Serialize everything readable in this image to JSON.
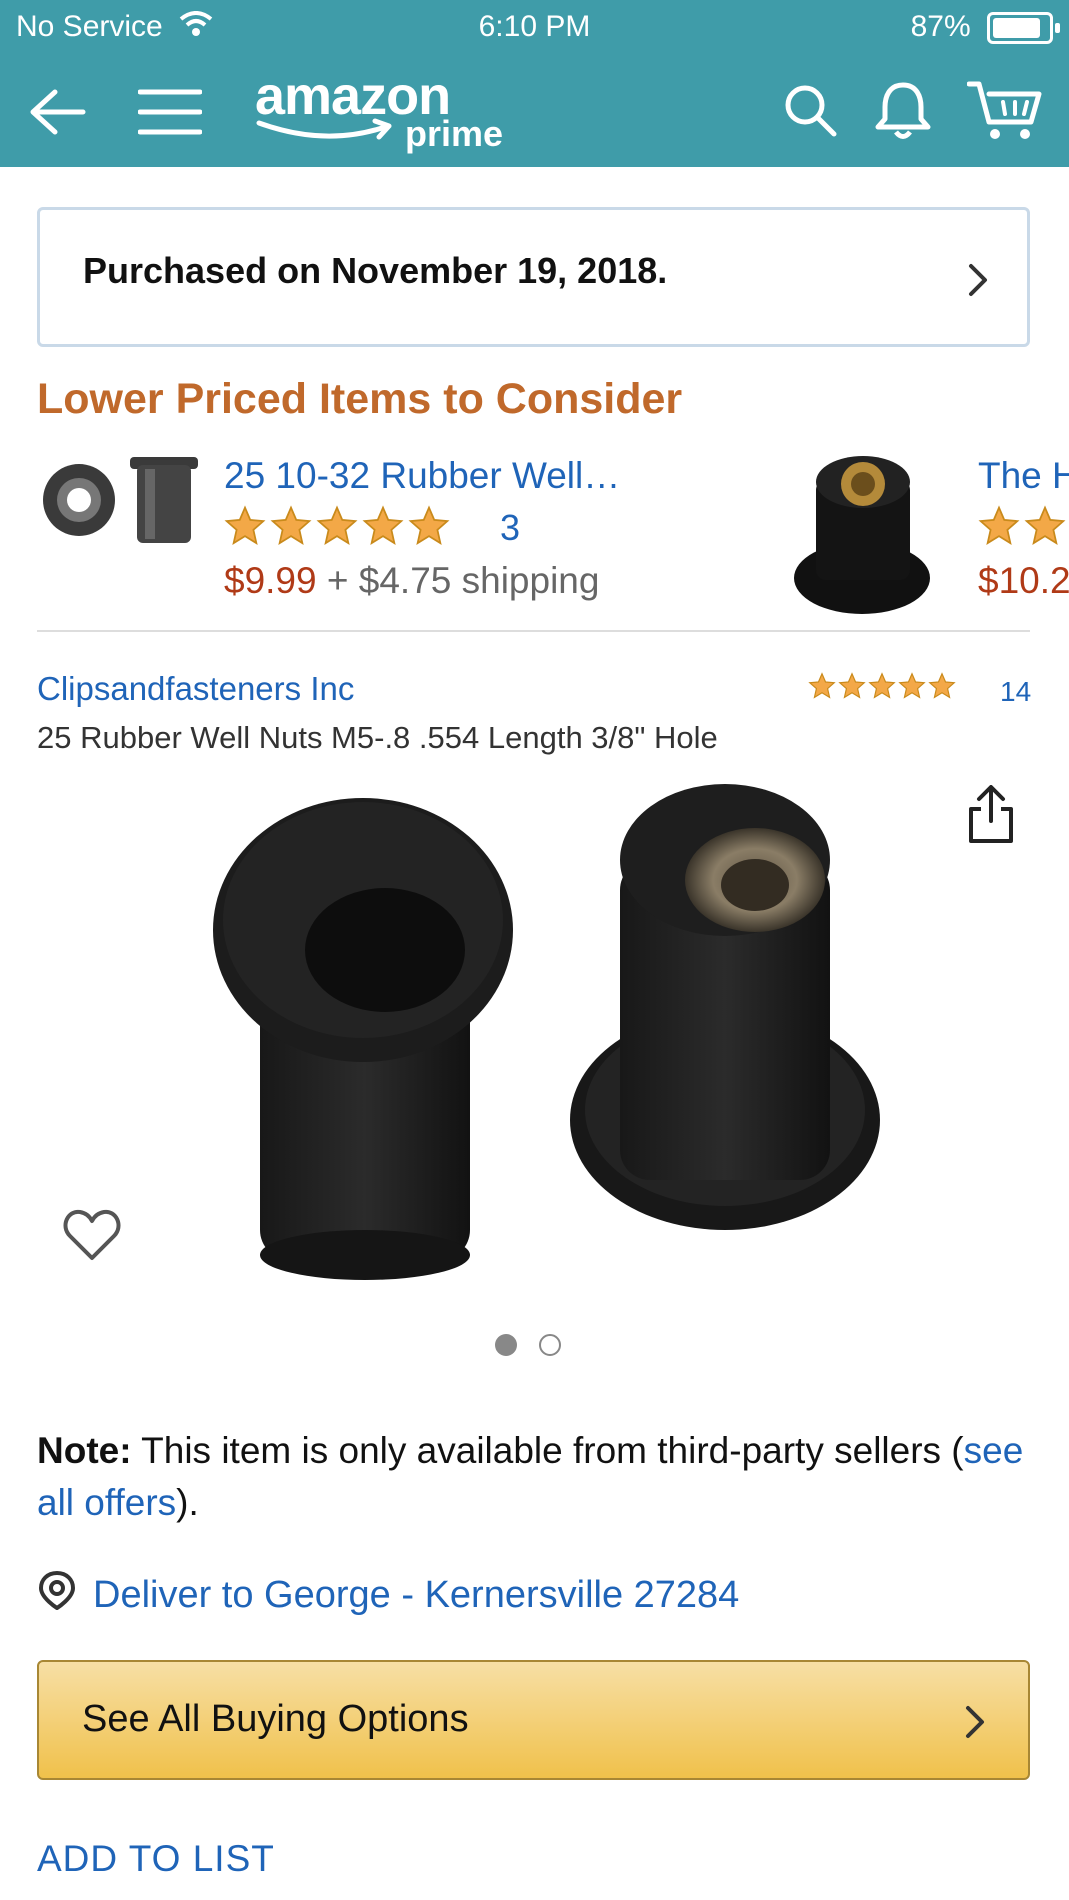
{
  "status_bar": {
    "carrier": "No Service",
    "time": "6:10 PM",
    "battery": "87%",
    "battery_level": 0.87
  },
  "nav": {
    "logo_main": "amazon",
    "logo_sub": "prime"
  },
  "purchased_banner": {
    "text": "Purchased on November 19, 2018."
  },
  "lower_priced": {
    "title": "Lower Priced Items to Consider",
    "items": [
      {
        "title": "25 10-32 Rubber Well…",
        "rating": 5,
        "review_count": "3",
        "price": "$9.99",
        "shipping": "+ $4.75 shipping"
      },
      {
        "title": "The H",
        "rating": 5,
        "price": "$10.2"
      }
    ]
  },
  "product": {
    "seller": "Clipsandfasteners Inc",
    "rating": 5,
    "review_count": "14",
    "name": "25 Rubber Well Nuts M5-.8 .554 Length 3/8\" Hole",
    "image_count": 2,
    "image_index": 1
  },
  "note": {
    "label": "Note:",
    "text": " This item is only available from third-party sellers (",
    "link": "see all offers",
    "tail": ")."
  },
  "deliver": {
    "text": "Deliver to George - Kernersville 27284"
  },
  "buy_button": {
    "label": "See All Buying Options"
  },
  "add_to_list": {
    "label": "ADD TO LIST"
  },
  "colors": {
    "header": "#3f9ca9",
    "accent_orange": "#c0692b",
    "link_blue": "#1f64b8",
    "price_red": "#b03a17",
    "star": "#f3a847",
    "button_yellow": "#f0c14b"
  }
}
